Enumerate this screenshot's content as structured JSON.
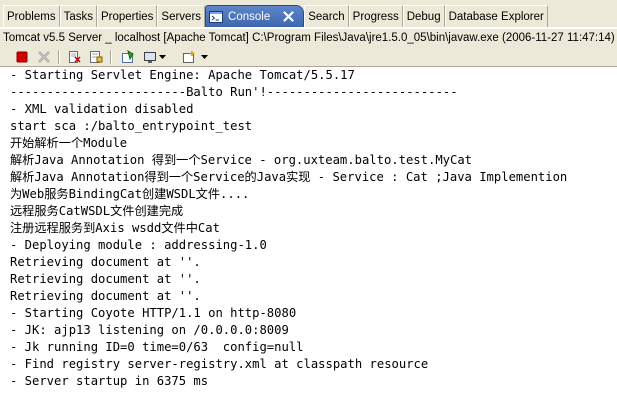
{
  "tabs": [
    "Problems",
    "Tasks",
    "Properties",
    "Servers",
    "Console",
    "Search",
    "Progress",
    "Debug",
    "Database Explorer"
  ],
  "active_tab": "Console",
  "icons": {
    "console": "console-icon",
    "close": "close-icon",
    "terminate": "terminate-icon",
    "remove": "remove-launch-icon",
    "clear": "clear-console-icon",
    "scroll_lock": "scroll-lock-icon",
    "pin": "pin-console-icon",
    "display_selected": "display-selected-console-icon",
    "open_console": "open-console-icon",
    "dropdown": "chevron-down-icon"
  },
  "title": "Tomcat v5.5 Server _ localhost [Apache Tomcat] C:\\Program Files\\Java\\jre1.5.0_05\\bin\\javaw.exe (2006-11-27 11:47:14)",
  "console_lines": [
    "- Starting Servlet Engine: Apache Tomcat/5.5.17",
    "------------------------Balto Run'!--------------------------",
    "- XML validation disabled",
    "start sca :/balto_entrypoint_test",
    "开始解析一个Module",
    "解析Java Annotation 得到一个Service - org.uxteam.balto.test.MyCat",
    "解析Java Annotation得到一个Service的Java实现 - Service : Cat ;Java Implemention",
    "为Web服务BindingCat创建WSDL文件....",
    "远程服务CatWSDL文件创建完成",
    "注册远程服务到Axis wsdd文件中Cat",
    "- Deploying module : addressing-1.0",
    "Retrieving document at ''.",
    "Retrieving document at ''.",
    "Retrieving document at ''.",
    "- Starting Coyote HTTP/1.1 on http-8080",
    "- JK: ajp13 listening on /0.0.0.0:8009",
    "- Jk running ID=0 time=0/63  config=null",
    "- Find registry server-registry.xml at classpath resource",
    "- Server startup in 6375 ms"
  ],
  "colors": {
    "chrome": "#ece9d8",
    "active_tab": "#4a72bb",
    "terminate": "#d40000",
    "console_text": "#000000"
  }
}
